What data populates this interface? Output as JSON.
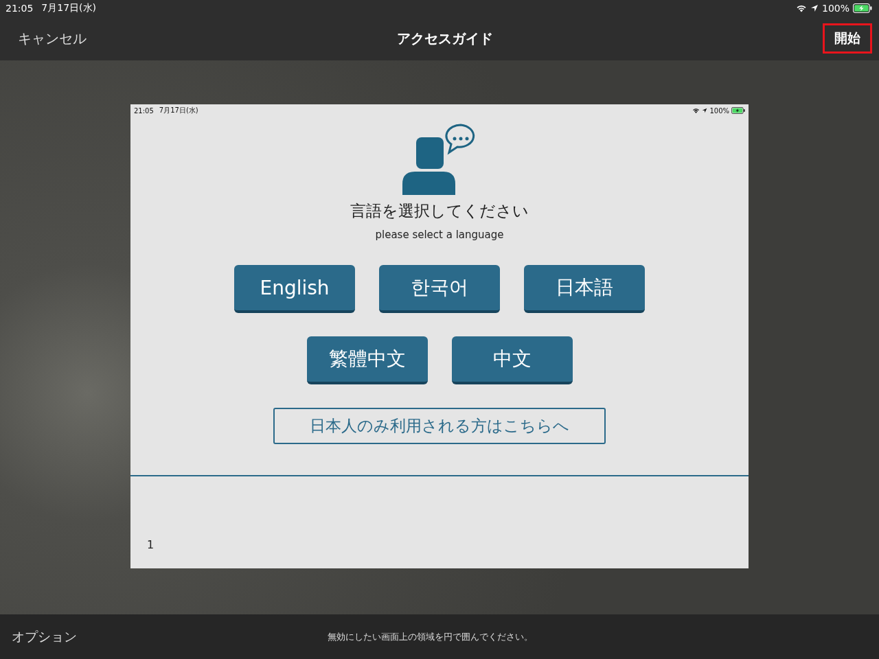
{
  "status_bar": {
    "time": "21:05",
    "date": "7月17日(水)",
    "battery": "100%"
  },
  "nav_bar": {
    "cancel": "キャンセル",
    "title": "アクセスガイド",
    "start": {
      "label": "開始",
      "highlighted": true
    }
  },
  "preview": {
    "status_bar": {
      "time": "21:05",
      "date": "7月17日(水)",
      "battery": "100%"
    },
    "heading": "言語を選択してください",
    "subheading": "please select a language",
    "language_rows": [
      [
        "English",
        "한국어",
        "日本語"
      ],
      [
        "繁體中文",
        "中文"
      ]
    ],
    "japanese_only_link": "日本人のみ利用される方はこちらへ",
    "page_number": "1"
  },
  "bottom_bar": {
    "options": "オプション",
    "hint": "無効にしたい画面上の領域を円で囲んでください。"
  }
}
